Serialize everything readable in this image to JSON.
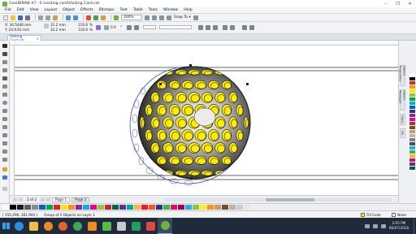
{
  "window": {
    "title": "CorelDRAW X7 - E:\\visiting card\\Visiting Card.cdr",
    "controls": [
      "–",
      "❐",
      "✕"
    ]
  },
  "menu": [
    "File",
    "Edit",
    "View",
    "Layout",
    "Object",
    "Effects",
    "Bitmaps",
    "Text",
    "Table",
    "Tools",
    "Window",
    "Help"
  ],
  "toolbar": {
    "zoom": "200%",
    "snap_label": "Snap To",
    "snap_arrow": "▾"
  },
  "properties": {
    "x": "X: 34.5446 mm",
    "y": "Y: 24.9.61 mm",
    "width": "31.2 mm",
    "height": "31.2 mm",
    "scale_w": "116.6",
    "scale_h": "116.6",
    "scale_unit": "%",
    "angle": "0.0",
    "angle_unit": "°"
  },
  "document_tab": {
    "label": "Visiting Card.cdr",
    "close": "×"
  },
  "docker_tabs": [
    "Object Properties",
    "Object Manager",
    "Hints",
    "Fill"
  ],
  "page_nav": {
    "counter": "2 of 2",
    "pages": [
      "Page 1",
      "Page 2"
    ],
    "active_page": 0
  },
  "status": {
    "coords": "( 155.296, 261.944 )",
    "selection": "Group of 2 Objects on Layer 1",
    "fill_label": "Fill Color",
    "outline_label": "None"
  },
  "taskbar": {
    "time": "2:05 PM",
    "date": "06/07/2018"
  },
  "colors": {
    "ball_yellow": "#ffee00",
    "ball_dark": "#1a1a1a",
    "accent": "#2a6fb6",
    "palette_h": [
      "#ffffff",
      "#000000",
      "#1c1c1c",
      "#5a5a5a",
      "#8a8a8a",
      "#0a60c0",
      "#00a651",
      "#e31e24",
      "#ffe600",
      "#f7941d",
      "#92278f",
      "#00aeef",
      "#ec008c",
      "#8dc63f",
      "#c1272d",
      "#006837",
      "#662d91",
      "#00a99d",
      "#fbb040",
      "#ed1c24",
      "#f15a24",
      "#2e3192",
      "#39b54a",
      "#d4145a",
      "#9e005d",
      "#29abe2",
      "#8cc63f",
      "#fcee21",
      "#f7931e",
      "#c69c6d",
      "#754c24",
      "#b3b3b3",
      "#cccccc",
      "#e6e6e6"
    ],
    "palette_v": [
      "#ffffff",
      "#000000",
      "#e31e24",
      "#f7941d",
      "#ffe600",
      "#8dc63f",
      "#00a651",
      "#00aeef",
      "#0a60c0",
      "#2e3192",
      "#92278f",
      "#ec008c",
      "#c1272d",
      "#754c24",
      "#c69c6d",
      "#b3b3b3",
      "#808080",
      "#4d4d4d",
      "#29abe2",
      "#39b54a",
      "#fbb040",
      "#d4145a",
      "#662d91",
      "#006837"
    ]
  }
}
